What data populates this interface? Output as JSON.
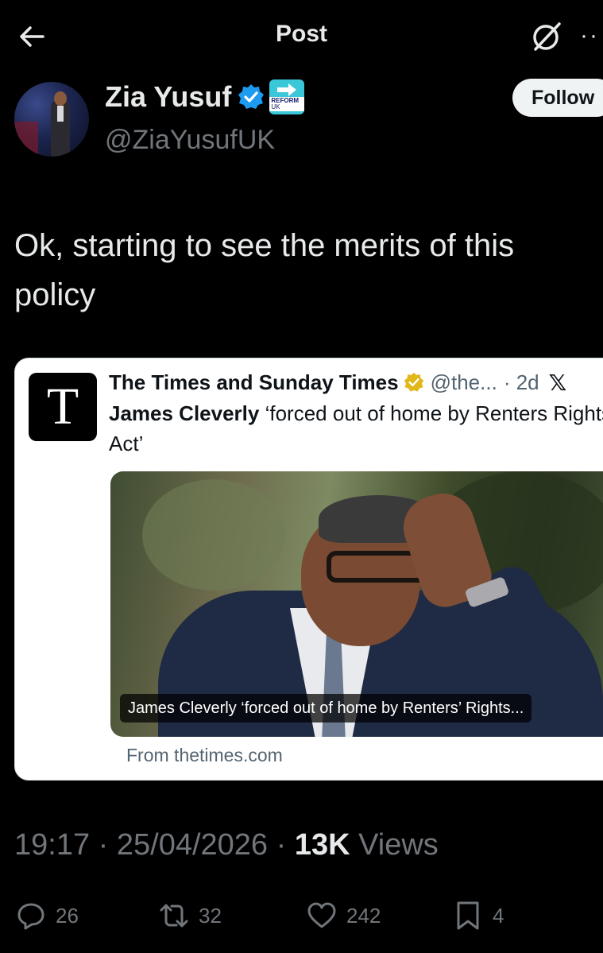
{
  "topbar": {
    "title": "Post",
    "more": "··"
  },
  "author": {
    "name": "Zia Yusuf",
    "handle": "@ZiaYusufUK",
    "follow_label": "Follow",
    "badge": {
      "line1": "REFORM",
      "line2": "UK"
    }
  },
  "post": {
    "text": "Ok, starting to see the merits of this policy"
  },
  "card": {
    "logo_letter": "T",
    "source_name": "The Times and Sunday Times",
    "source_handle": "@the...",
    "age": "· 2d",
    "headline_bold": "James Cleverly",
    "headline_rest": " ‘forced out of home by Renters Rights Act’",
    "image_caption": "James Cleverly ‘forced out of home by Renters’ Rights...",
    "from": "From thetimes.com"
  },
  "meta": {
    "time": "19:17",
    "date": "25/04/2026",
    "views_count": "13K",
    "views_label": "Views"
  },
  "actions": {
    "replies": "26",
    "reposts": "32",
    "likes": "242",
    "bookmarks": "4"
  },
  "colors": {
    "background": "#000000",
    "text": "#e7e9ea",
    "muted": "#71767b",
    "verified_blue": "#1d9bf0",
    "verified_gold": "#e2b719",
    "reform_teal": "#3ac8d8"
  },
  "icons": [
    "back-arrow-icon",
    "grok-icon",
    "verified-badge-icon",
    "reform-uk-badge-icon",
    "gold-verified-icon",
    "x-logo-icon",
    "reply-icon",
    "repost-icon",
    "like-icon",
    "bookmark-icon"
  ]
}
